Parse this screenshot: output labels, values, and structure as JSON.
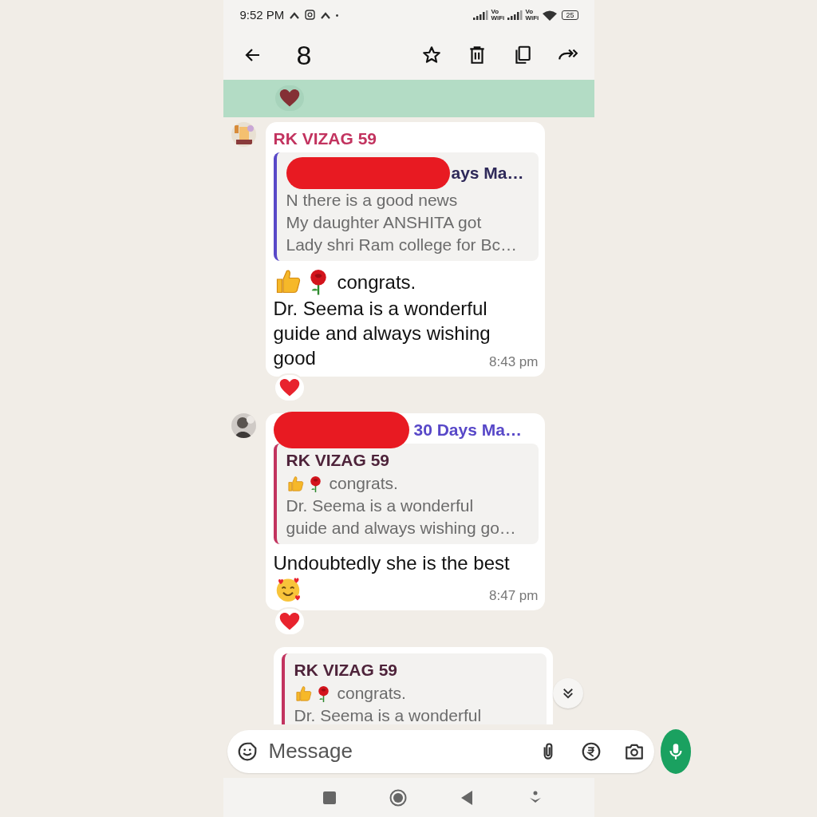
{
  "status_bar": {
    "time": "9:52 PM",
    "sim_labels": [
      {
        "top": "Vo",
        "bottom": "WiFi"
      },
      {
        "top": "Vo",
        "bottom": "WiFi"
      }
    ],
    "battery": "25"
  },
  "toolbar": {
    "selected_count": "8"
  },
  "messages": [
    {
      "kind": "clipped",
      "selected": true,
      "reactions": [
        {
          "kind": "heart"
        }
      ]
    },
    {
      "kind": "incoming",
      "selected": false,
      "avatar": true,
      "sender": {
        "name": "RK VIZAG 59",
        "redacted": false,
        "color": "#c2335f"
      },
      "quote": {
        "author": "ays Ma…",
        "redacted": true,
        "color": "#5848c8",
        "lines": [
          {
            "text": "N there is a good news"
          },
          {
            "text": "My daughter ANSHITA got"
          },
          {
            "text": "Lady shri Ram college for Bc…"
          }
        ]
      },
      "body": [
        {
          "emojis": [
            {
              "kind": "thumbs_up"
            },
            {
              "kind": "rose"
            }
          ],
          "text": "congrats."
        },
        {
          "text": "Dr. Seema is a wonderful"
        },
        {
          "text": "guide and always wishing"
        },
        {
          "text": "good"
        }
      ],
      "time": "8:43 pm",
      "reactions": [
        {
          "kind": "heart"
        }
      ]
    },
    {
      "kind": "incoming",
      "selected": false,
      "avatar": true,
      "sender": {
        "name": "30 Days Ma…",
        "redacted": true,
        "color": "#5848c8"
      },
      "quote": {
        "author": "RK VIZAG 59",
        "redacted": false,
        "color": "#c2335f",
        "lines": [
          {
            "emojis": [
              {
                "kind": "thumbs_up"
              },
              {
                "kind": "rose"
              }
            ],
            "text": "congrats."
          },
          {
            "text": "Dr. Seema is a wonderful"
          },
          {
            "text": "guide and always wishing go…"
          }
        ]
      },
      "body": [
        {
          "text": "Undoubtedly she is the best"
        },
        {
          "emojis": [
            {
              "kind": "smiling_hearts"
            }
          ]
        }
      ],
      "time": "8:47 pm",
      "reactions": [
        {
          "kind": "heart"
        }
      ]
    },
    {
      "kind": "incoming",
      "selected": false,
      "avatar": false,
      "quote": {
        "author": "RK VIZAG 59",
        "redacted": false,
        "color": "#c2335f",
        "lines": [
          {
            "emojis": [
              {
                "kind": "thumbs_up"
              },
              {
                "kind": "rose"
              }
            ],
            "text": "congrats."
          },
          {
            "text": "Dr. Seema is a wonderful"
          }
        ]
      }
    }
  ],
  "composer": {
    "placeholder": "Message"
  }
}
